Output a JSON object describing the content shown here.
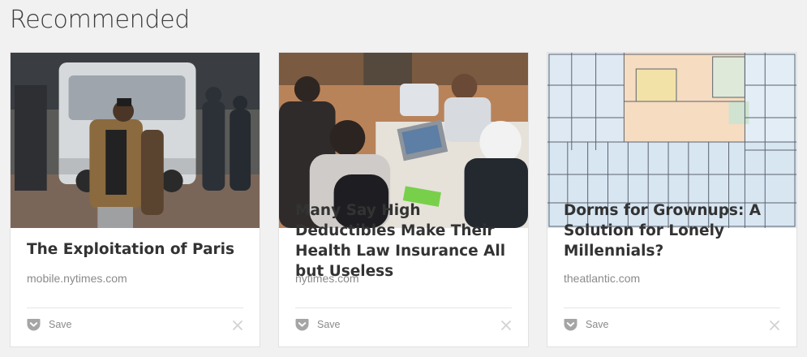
{
  "page": {
    "title": "Recommended"
  },
  "cards": [
    {
      "title": "The Exploitation of Paris",
      "domain": "mobile.nytimes.com",
      "save_label": "Save"
    },
    {
      "title": "Many Say High Deductibles Make Their Health Law Insurance All but Useless",
      "domain": "nytimes.com",
      "save_label": "Save"
    },
    {
      "title": "Dorms for Grownups: A Solution for Lonely Millennials?",
      "domain": "theatlantic.com",
      "save_label": "Save"
    }
  ],
  "icons": {
    "save": "pocket-icon",
    "dismiss": "close-icon"
  },
  "colors": {
    "background": "#f1f1f1",
    "card": "#ffffff",
    "title_text": "#333333",
    "meta_text": "#8a8a8a",
    "pocket_icon": "#a5a5a5"
  }
}
